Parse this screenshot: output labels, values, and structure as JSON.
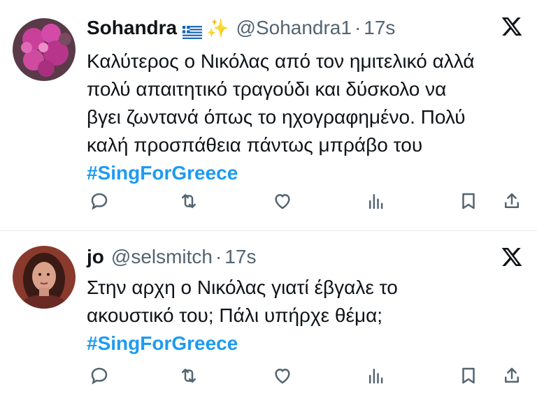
{
  "tweets": [
    {
      "name": "Sohandra",
      "sparkle": "✨",
      "handle": "@Sohandra1",
      "separator": "·",
      "time": "17s",
      "lines": [
        "Καλύτερος ο Νικόλας από τον ημιτελικό αλλά",
        "πολύ απαιτητικό τραγούδι και δύσκολο να",
        "βγει ζωντανά όπως το ηχογραφημένο. Πολύ",
        "καλή προσπάθεια πάντως μπράβο του"
      ],
      "hashtag": "#SingForGreece",
      "avatar": "bougainvillea-flowers-avatar"
    },
    {
      "name": "jo",
      "handle": "@selsmitch",
      "separator": "·",
      "time": "17s",
      "lines": [
        "Στην αρχη ο Νικόλας γιατί έβγαλε το",
        "ακουστικό του; Πάλι υπήρχε θέμα;"
      ],
      "hashtag": "#SingForGreece",
      "avatar": "woman-portrait-avatar"
    }
  ],
  "icons": [
    "reply-icon",
    "retweet-icon",
    "like-icon",
    "views-icon",
    "bookmark-icon",
    "share-icon",
    "x-logo-icon",
    "greece-flag-icon"
  ],
  "colors": {
    "text": "#0f1419",
    "secondary": "#536471",
    "hashtag": "#1d9bf0",
    "divider": "#e6e9eb"
  }
}
